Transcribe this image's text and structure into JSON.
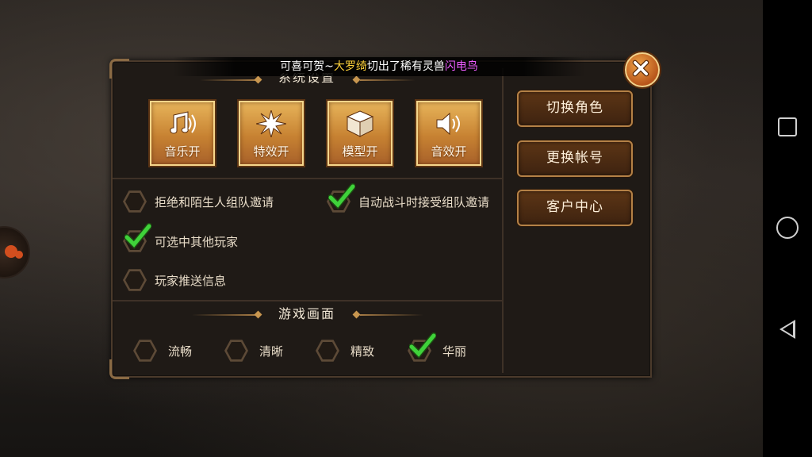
{
  "notice": {
    "prefix": "可喜可贺~",
    "player": "大罗绮",
    "middle": "切出了稀有灵兽",
    "pet": "闪电鸟"
  },
  "system_title": "系统设置",
  "toggles": [
    {
      "label": "音乐开",
      "icon": "music-note-icon"
    },
    {
      "label": "特效开",
      "icon": "burst-icon"
    },
    {
      "label": "模型开",
      "icon": "cube-icon"
    },
    {
      "label": "音效开",
      "icon": "speaker-icon"
    }
  ],
  "options": [
    {
      "label": "拒绝和陌生人组队邀请",
      "checked": false
    },
    {
      "label": "自动战斗时接受组队邀请",
      "checked": true
    },
    {
      "label": "可选中其他玩家",
      "checked": true
    },
    {
      "label": "玩家推送信息",
      "checked": false
    }
  ],
  "graphics_title": "游戏画面",
  "graphics": [
    {
      "label": "流畅",
      "checked": false
    },
    {
      "label": "清晰",
      "checked": false
    },
    {
      "label": "精致",
      "checked": false
    },
    {
      "label": "华丽",
      "checked": true
    }
  ],
  "account_buttons": [
    "切换角色",
    "更换帐号",
    "客户中心"
  ],
  "colors": {
    "accent_gold": "#d49a45",
    "notice_player": "#ffd23a",
    "notice_pet": "#ee5cff",
    "check_green": "#3fd23a"
  }
}
